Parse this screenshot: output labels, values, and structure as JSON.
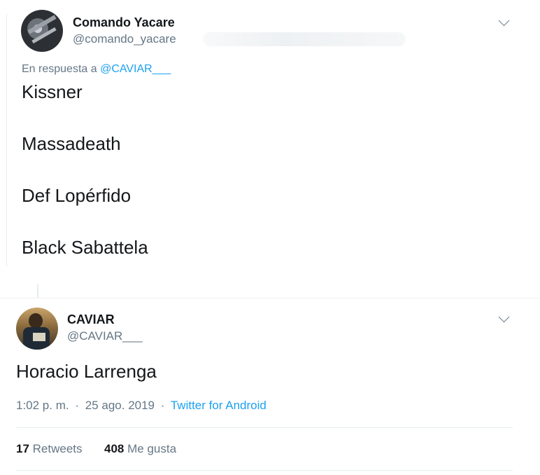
{
  "reply_tweet": {
    "author_name": "Comando Yacare",
    "author_handle": "@comando_yacare",
    "reply_prefix": "En respuesta a",
    "reply_to": "@CAVIAR___",
    "lines": [
      "Kissner",
      "Massadeath",
      "Def Lopérfido",
      "Black Sabattela"
    ]
  },
  "main_tweet": {
    "author_name": "CAVIAR",
    "author_handle": "@CAVIAR___",
    "text": "Horacio Larrenga",
    "time": "1:02 p. m.",
    "separator": "·",
    "date": "25 ago. 2019",
    "via": "Twitter for Android",
    "retweets_count": "17",
    "retweets_label": "Retweets",
    "likes_count": "408",
    "likes_label": "Me gusta"
  },
  "icons": {
    "menu": "chevron-down-icon"
  },
  "colors": {
    "link": "#1da1f2",
    "secondary_text": "#657786",
    "primary_text": "#14171a",
    "divider": "#e6ecf0"
  }
}
